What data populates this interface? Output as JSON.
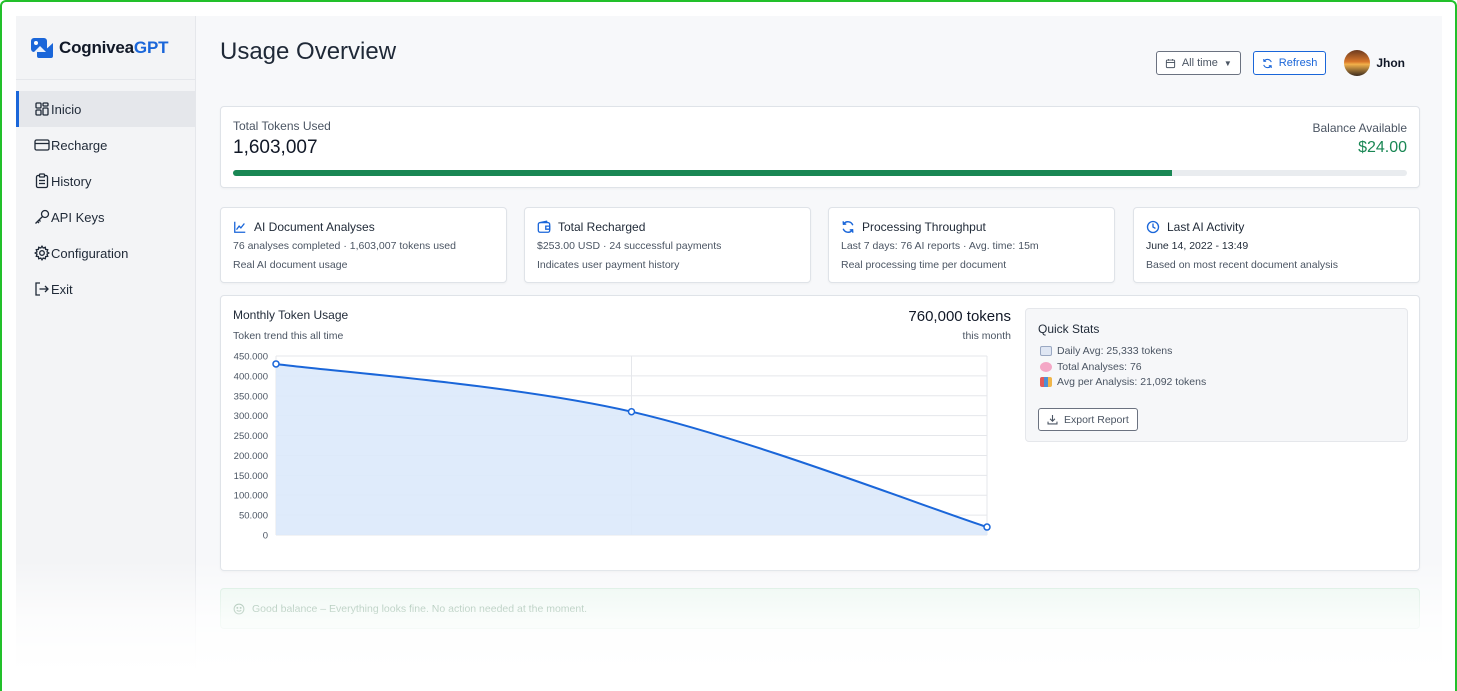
{
  "brand": {
    "name_main": "Cognivea",
    "name_accent": "GPT"
  },
  "sidebar": {
    "items": [
      {
        "label": "Inicio",
        "icon": "dashboard-icon",
        "active": true
      },
      {
        "label": "Recharge",
        "icon": "credit-card-icon"
      },
      {
        "label": "History",
        "icon": "clipboard-icon"
      },
      {
        "label": "API Keys",
        "icon": "key-icon"
      },
      {
        "label": "Configuration",
        "icon": "gear-icon"
      },
      {
        "label": "Exit",
        "icon": "exit-icon"
      }
    ]
  },
  "header": {
    "title": "Usage Overview",
    "date_filter": "All time",
    "refresh_label": "Refresh",
    "user_name": "Jhon"
  },
  "tokens": {
    "label": "Total Tokens Used",
    "value": "1,603,007",
    "balance_label": "Balance Available",
    "balance_value": "$24.00",
    "progress_fraction": 0.8
  },
  "stats": [
    {
      "title": "AI Document Analyses",
      "icon": "line-chart-icon",
      "line1": "76 analyses completed · 1,603,007 tokens used",
      "line2": "Real AI document usage"
    },
    {
      "title": "Total Recharged",
      "icon": "wallet-icon",
      "line1": "$253.00 USD · 24 successful payments",
      "line2": "Indicates user payment history"
    },
    {
      "title": "Processing Throughput",
      "icon": "refresh-icon",
      "line1": "Last 7 days: 76 AI reports · Avg. time: 15m",
      "line2": "Real processing time per document"
    },
    {
      "title": "Last AI Activity",
      "icon": "clock-icon",
      "line1": "June 14, 2022 - 13:49",
      "line2": "Based on most recent document analysis"
    }
  ],
  "chart_panel": {
    "title": "Monthly Token Usage",
    "subtitle": "Token trend this all time",
    "big_value": "760,000 tokens",
    "big_sub": "this month"
  },
  "chart_data": {
    "type": "area",
    "x": [
      0,
      1,
      2
    ],
    "values": [
      430000,
      310000,
      20000
    ],
    "yticks": [
      "450.000",
      "400.000",
      "350.000",
      "300.000",
      "250.000",
      "200.000",
      "150.000",
      "100.000",
      "50.000",
      "0"
    ],
    "ylim": [
      0,
      450000
    ],
    "grid": true,
    "line_color": "#1a66d9",
    "fill_color": "#dbe9fb"
  },
  "quick_stats": {
    "title": "Quick Stats",
    "rows": [
      {
        "text": "Daily Avg: 25,333 tokens",
        "icon": "calendar-icon"
      },
      {
        "text": "Total Analyses: 76",
        "icon": "brain-icon"
      },
      {
        "text": "Avg per Analysis: 21,092 tokens",
        "icon": "bar-chart-icon"
      }
    ],
    "export_label": "Export Report"
  },
  "alert": {
    "text": "Good balance – Everything looks fine. No action needed at the moment."
  },
  "colors": {
    "accent": "#1a66d9",
    "success": "#198754"
  }
}
